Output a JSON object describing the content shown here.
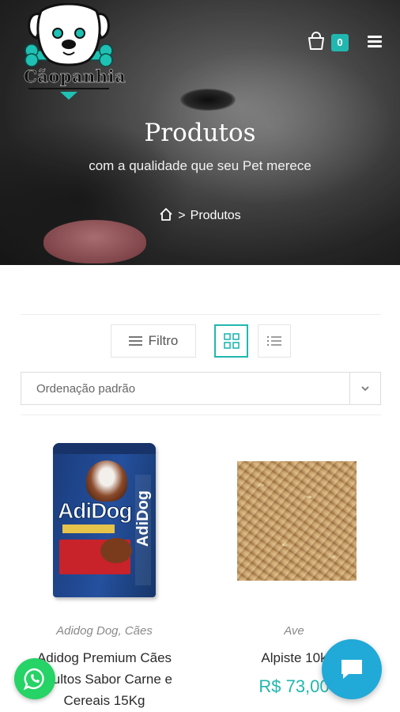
{
  "header": {
    "logo_text": "Cãopanhia",
    "cart_count": "0",
    "icons": {
      "cart": "shopping-bag-icon",
      "menu": "hamburger-menu-icon"
    }
  },
  "hero": {
    "title": "Produtos",
    "subtitle": "com a qualidade que seu Pet merece",
    "breadcrumb": {
      "separator": ">",
      "current": "Produtos",
      "home_icon": "home-icon"
    }
  },
  "toolbar": {
    "filter_label": "Filtro",
    "grid_view_icon": "grid-view-icon",
    "list_view_icon": "list-view-icon",
    "sort_selected": "Ordenação padrão"
  },
  "products": [
    {
      "image_label": "AdiDog",
      "image_side_label": "AdiDog",
      "category": "Adidog Dog, Cães",
      "name": "Adidog Premium Cães Adultos Sabor Carne e Cereais 15Kg",
      "price": ""
    },
    {
      "category": "Ave",
      "name": "Alpiste 10k",
      "price": "R$ 73,00"
    }
  ],
  "floating": {
    "whatsapp_icon": "whatsapp-icon",
    "chat_icon": "chat-icon"
  },
  "colors": {
    "accent": "#21b7b0",
    "whatsapp": "#25d366",
    "chat": "#21a9d8"
  }
}
